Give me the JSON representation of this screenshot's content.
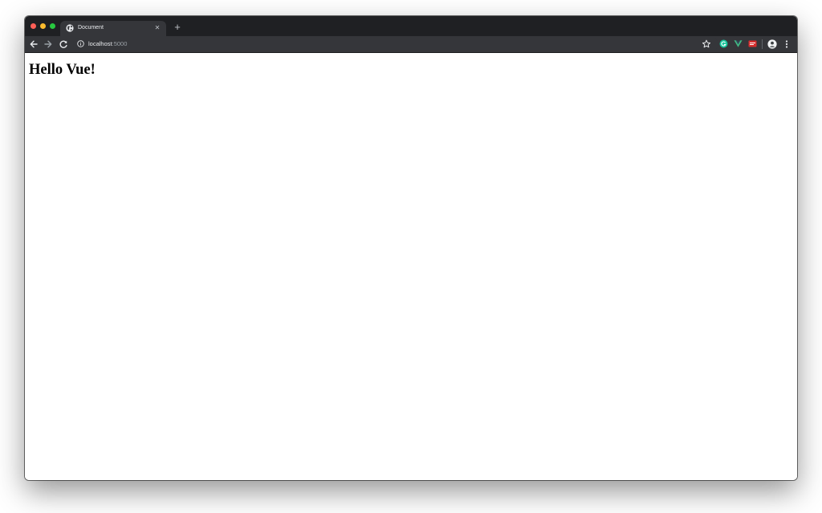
{
  "browser": {
    "tab": {
      "title": "Document",
      "close_glyph": "✕",
      "favicon": "globe-icon"
    },
    "new_tab_glyph": "+",
    "toolbar": {
      "back_icon": "arrow-left-icon",
      "forward_icon": "arrow-right-icon",
      "reload_icon": "reload-icon",
      "info_icon": "info-icon",
      "url_host": "localhost",
      "url_port": ":5000",
      "bookmark_icon": "star-icon",
      "extensions": [
        "grammarly-extension-icon",
        "vue-devtools-icon",
        "extension-red-icon"
      ],
      "profile_icon": "avatar",
      "menu_icon": "more-vert-icon"
    }
  },
  "page": {
    "heading": "Hello Vue!"
  },
  "colors": {
    "frame": "#1f2023",
    "toolbar": "#35363a",
    "traffic_close": "#fe5f57",
    "traffic_minimize": "#febc2e",
    "traffic_zoom": "#28c840",
    "vue_green": "#41b883",
    "grammarly_green": "#15c39a",
    "ext_red": "#d72d2d"
  }
}
